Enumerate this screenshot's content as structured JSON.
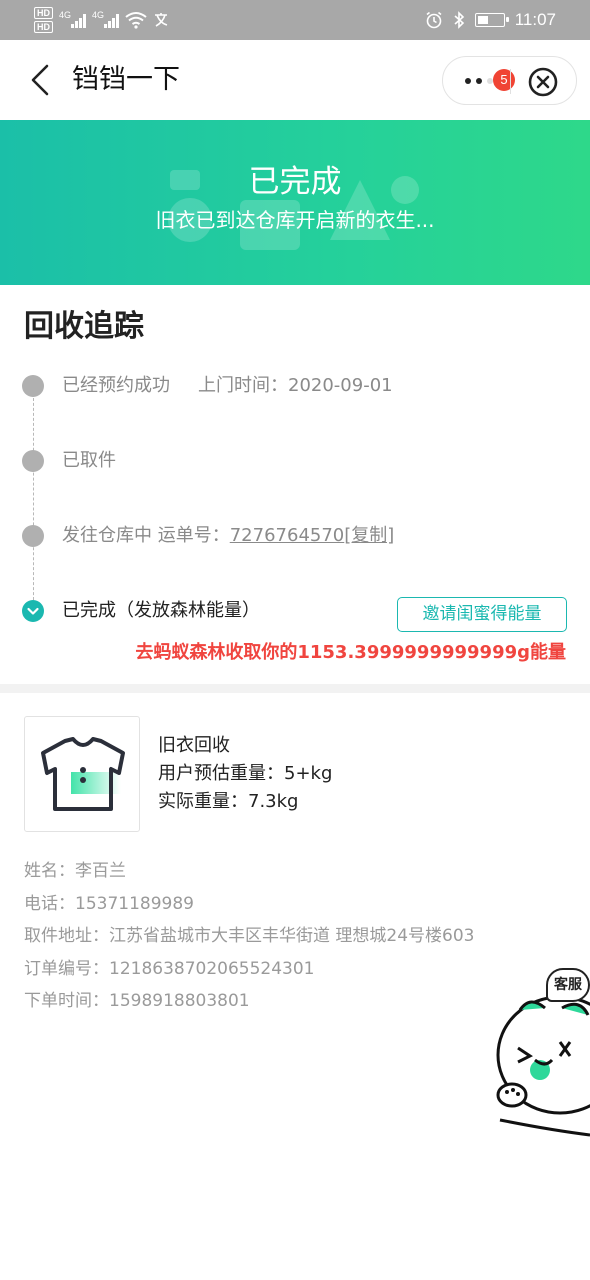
{
  "status_bar": {
    "hd1": "HD",
    "hd2": "HD",
    "net1": "4G",
    "net2": "4G",
    "time": "11:07"
  },
  "nav": {
    "title": "铛铛一下",
    "badge_count": "5"
  },
  "banner": {
    "title": "已完成",
    "subtitle": "旧衣已到达仓库开启新的衣生..."
  },
  "tracking": {
    "title": "回收追踪",
    "steps": [
      {
        "label": "已经预约成功",
        "extra": "上门时间：2020-09-01",
        "status": "done-grey"
      },
      {
        "label": "已取件",
        "status": "done-grey"
      },
      {
        "label": "发往仓库中 运单号：",
        "tracking_no": "7276764570",
        "copy": "[复制]",
        "status": "done-grey"
      },
      {
        "label": "已完成（发放森林能量）",
        "status": "current"
      }
    ],
    "invite_button": "邀请闺蜜得能量",
    "energy_text": "去蚂蚁森林收取你的1153.3999999999999g能量"
  },
  "product": {
    "name": "旧衣回收",
    "estimated_weight": "用户预估重量：5+kg",
    "actual_weight": "实际重量：7.3kg"
  },
  "order": {
    "name": "姓名：李百兰",
    "phone": "电话：15371189989",
    "address": "取件地址：江苏省盐城市大丰区丰华街道 理想城24号楼603",
    "order_no": "订单编号：1218638702065524301",
    "order_time": "下单时间：1598918803801"
  },
  "customer_service": {
    "label": "客服"
  },
  "colors": {
    "accent": "#1bb8b0",
    "banner_start": "#1bbfa8",
    "banner_end": "#2ed88a",
    "energy_red": "#f0453f",
    "badge_red": "#f04434"
  }
}
